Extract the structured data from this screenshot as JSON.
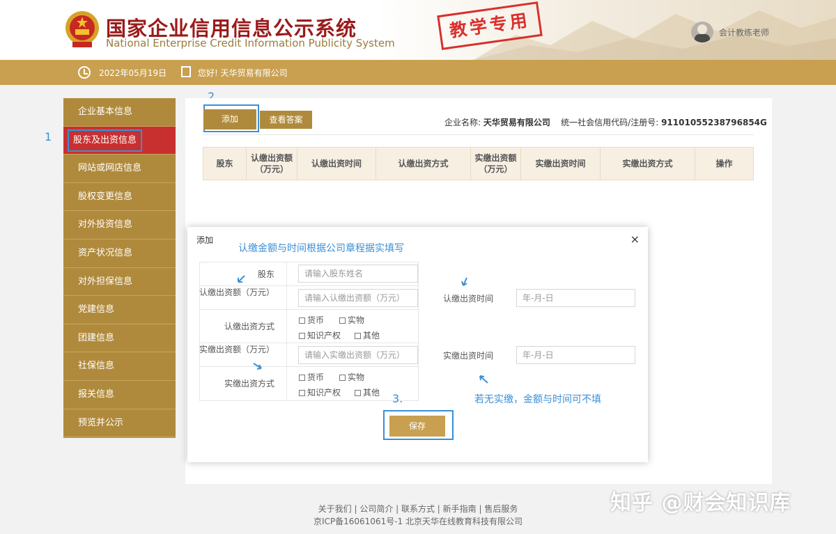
{
  "header": {
    "title_cn": "国家企业信用信息公示系统",
    "title_en": "National Enterprise Credit Information Publicity System",
    "stamp": "教学专用",
    "user_name": "会计教练老师"
  },
  "infobar": {
    "date": "2022年05月19日",
    "greeting": "您好! 天华贸易有限公司"
  },
  "sidebar": {
    "items": [
      {
        "label": "企业基本信息"
      },
      {
        "label": "股东及出资信息"
      },
      {
        "label": "网站或网店信息"
      },
      {
        "label": "股权变更信息"
      },
      {
        "label": "对外投资信息"
      },
      {
        "label": "资产状况信息"
      },
      {
        "label": "对外担保信息"
      },
      {
        "label": "党建信息"
      },
      {
        "label": "团建信息"
      },
      {
        "label": "社保信息"
      },
      {
        "label": "报关信息"
      },
      {
        "label": "预览并公示"
      }
    ]
  },
  "steps": {
    "s1": "1",
    "s2": "2.",
    "s3": "3."
  },
  "toolbar": {
    "add_label": "添加",
    "answer_label": "查看答案"
  },
  "company": {
    "name_label": "企业名称:",
    "name": "天华贸易有限公司",
    "code_label": "统一社会信用代码/注册号:",
    "code": "91101055238796854G"
  },
  "table": {
    "headers": [
      "股东",
      "认缴出资额（万元）",
      "认缴出资时间",
      "认缴出资方式",
      "实缴出资额（万元）",
      "实缴出资时间",
      "实缴出资方式",
      "操作"
    ]
  },
  "modal": {
    "title": "添加",
    "close": "×",
    "note_top": "认缴金额与时间根据公司章程据实填写",
    "note_bottom": "若无实缴，金额与时间可不填",
    "shareholder_label": "股东",
    "shareholder_placeholder": "请输入股东姓名",
    "sub_amount_label": "认缴出资额（万元）",
    "sub_amount_placeholder": "请输入认缴出资额（万元）",
    "sub_time_label": "认缴出资时间",
    "sub_time_placeholder": "年-月-日",
    "sub_method_label": "认缴出资方式",
    "paid_amount_label": "实缴出资额（万元）",
    "paid_amount_placeholder": "请输入实缴出资额（万元）",
    "paid_time_label": "实缴出资时间",
    "paid_time_placeholder": "年-月-日",
    "paid_method_label": "实缴出资方式",
    "methods": [
      "货币",
      "实物",
      "知识产权",
      "其他"
    ],
    "save_label": "保存"
  },
  "footer": {
    "links": "关于我们 | 公司简介 | 联系方式 | 新手指南 | 售后服务",
    "icp": "京ICP备16061061号-1 北京天华在线教育科技有限公司"
  },
  "watermark": "知乎 @财会知识库",
  "colors": {
    "gold": "#b08a3c",
    "active": "#c83030",
    "highlight": "#3a8fd6",
    "title_red": "#9a1b1b"
  }
}
